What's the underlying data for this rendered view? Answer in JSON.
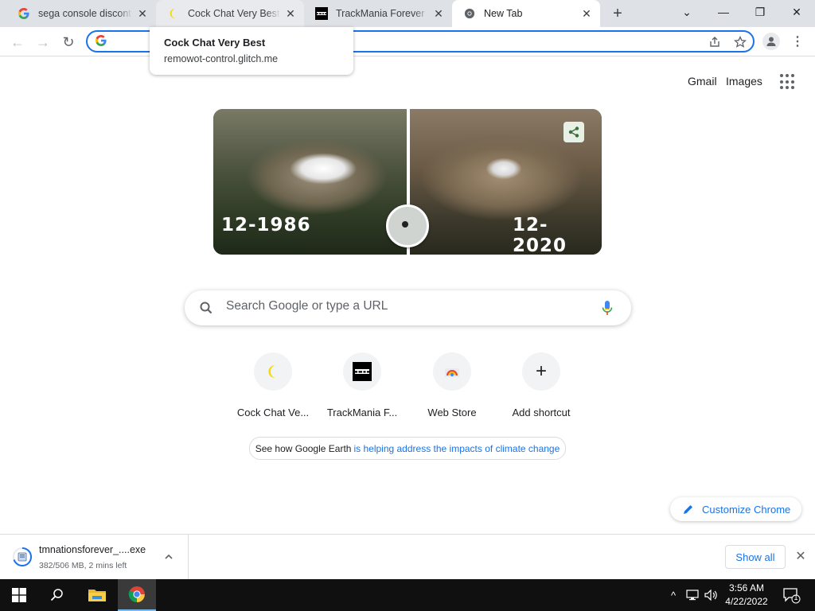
{
  "tabs": [
    {
      "title": "sega console discontinued",
      "favicon": "google-g-icon",
      "close": "✕"
    },
    {
      "title": "Cock Chat Very Best",
      "favicon": "moon-icon",
      "close": "✕"
    },
    {
      "title": "TrackMania Forever • T",
      "favicon": "trackmania-icon",
      "close": "✕"
    },
    {
      "title": "New Tab",
      "favicon": "chrome-icon",
      "close": "✕"
    }
  ],
  "window": {
    "new_tab": "+",
    "dropdown": "⌄",
    "minimize": "—",
    "restore": "❐",
    "close": "✕"
  },
  "toolbar": {
    "back": "←",
    "forward": "→",
    "reload": "↻",
    "omnibox_value": "",
    "menu": "⋮"
  },
  "tooltip": {
    "title": "Cock Chat Very Best",
    "url": "remowot-control.glitch.me"
  },
  "ntp": {
    "gmail": "Gmail",
    "images": "Images",
    "doodle": {
      "left_label": "12-1986",
      "right_label": "12-2020"
    },
    "search_placeholder": "Search Google or type a URL",
    "shortcuts": [
      {
        "label": "Cock Chat Ve...",
        "icon": "moon-icon"
      },
      {
        "label": "TrackMania F...",
        "icon": "trackmania-icon"
      },
      {
        "label": "Web Store",
        "icon": "web-store-icon"
      },
      {
        "label": "Add shortcut",
        "icon": "plus-icon",
        "glyph": "+"
      }
    ],
    "promo": {
      "text_plain": "See how Google Earth",
      "text_link": "is helping address the impacts of climate change"
    },
    "customize": "Customize Chrome"
  },
  "download": {
    "filename": "tmnationsforever_....exe",
    "status": "382/506 MB, 2 mins left",
    "show_all": "Show all",
    "close": "✕"
  },
  "taskbar": {
    "time": "3:56 AM",
    "date": "4/22/2022",
    "notification_count": "1",
    "tray_up": "^"
  },
  "colors": {
    "accent": "#1a73e8",
    "tabstrip": "#dee1e6",
    "taskbar": "#101010"
  }
}
